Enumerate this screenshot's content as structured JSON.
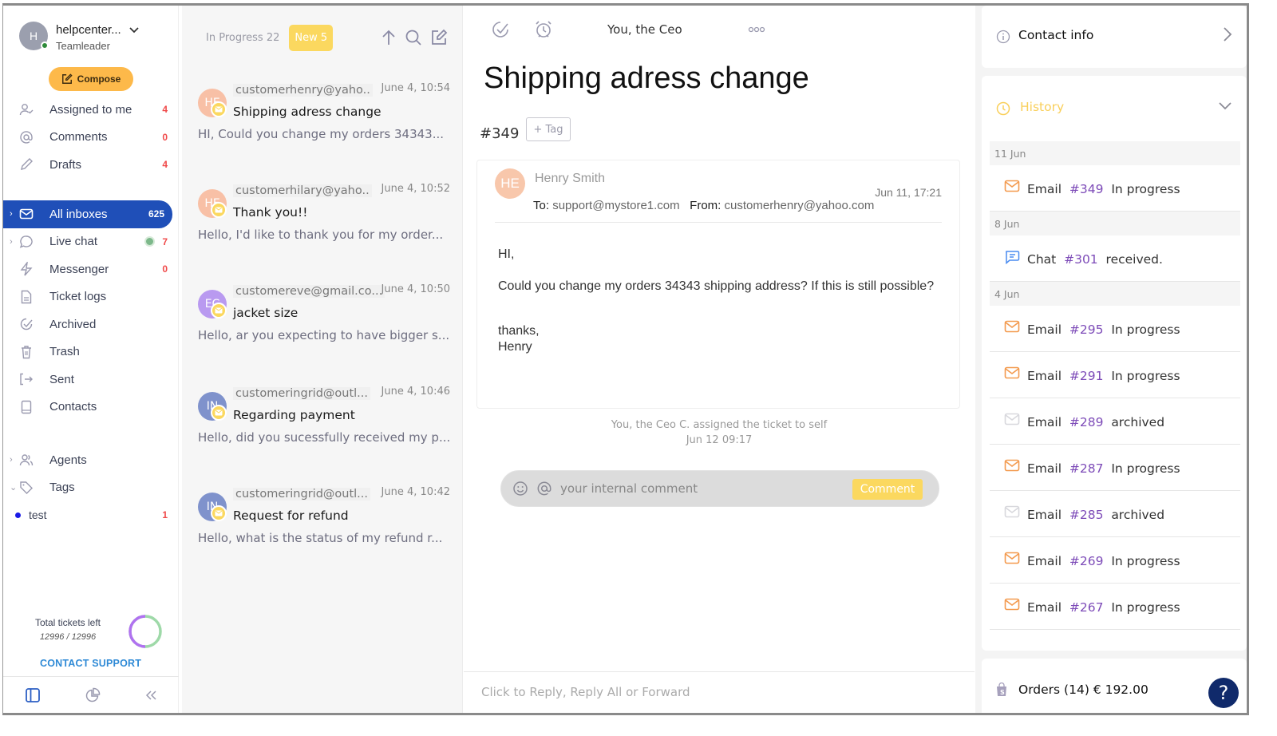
{
  "user": {
    "initial": "H",
    "name": "helpcenter...",
    "role": "Teamleader"
  },
  "compose_label": "Compose",
  "nav": [
    {
      "label": "Assigned to me",
      "count": "4",
      "icon": "user-check-icon"
    },
    {
      "label": "Comments",
      "count": "0",
      "icon": "at-icon"
    },
    {
      "label": "Drafts",
      "count": "4",
      "icon": "pencil-icon"
    }
  ],
  "inboxes": [
    {
      "label": "All inboxes",
      "count": "625",
      "icon": "mail-icon",
      "active": true
    },
    {
      "label": "Live chat",
      "count": "7",
      "icon": "chat-icon"
    },
    {
      "label": "Messenger",
      "count": "0",
      "icon": "bolt-icon"
    },
    {
      "label": "Ticket logs",
      "count": "",
      "icon": "document-icon"
    },
    {
      "label": "Archived",
      "count": "",
      "icon": "check-circle-icon"
    },
    {
      "label": "Trash",
      "count": "",
      "icon": "trash-icon"
    },
    {
      "label": "Sent",
      "count": "",
      "icon": "sign-out-icon"
    },
    {
      "label": "Contacts",
      "count": "",
      "icon": "book-icon"
    }
  ],
  "groups": [
    {
      "label": "Agents",
      "icon": "users-icon"
    },
    {
      "label": "Tags",
      "icon": "tag-icon"
    }
  ],
  "tags": [
    {
      "label": "test",
      "count": "1",
      "color": "#1a1ae6"
    }
  ],
  "tickets_left": {
    "label": "Total tickets left",
    "value": "12996 / 12996",
    "fraction": 1.0
  },
  "contact_support": "CONTACT SUPPORT",
  "list": {
    "tab_in_progress": "In Progress 22",
    "tab_new": "New 5",
    "conversations": [
      {
        "initials": "HE",
        "color": "#f8c0a6",
        "email": "customerhenry@yaho..",
        "time": "June 4, 10:54",
        "subject": "Shipping adress change",
        "preview": "HI, Could you change my orders 34343..."
      },
      {
        "initials": "HE",
        "color": "#f8c0a6",
        "email": "customerhilary@yaho..",
        "time": "June 4, 10:52",
        "subject": "Thank you!!",
        "preview": "Hello, I'd like to thank you for  my order..."
      },
      {
        "initials": "EC",
        "color": "#b99af0",
        "email": "customereve@gmail.co...",
        "time": "June 4, 10:50",
        "subject": "jacket size",
        "preview": "Hello, ar you expecting to have bigger s..."
      },
      {
        "initials": "IN",
        "color": "#7f92cc",
        "email": "customeringrid@outl...",
        "time": "June 4, 10:46",
        "subject": "Regarding payment",
        "preview": "Hello, did you sucessfully received my p..."
      },
      {
        "initials": "IN",
        "color": "#7f92cc",
        "email": "customeringrid@outl...",
        "time": "June 4, 10:42",
        "subject": "Request for refund",
        "preview": "Hello, what is the status of my refund r..."
      }
    ]
  },
  "ticket": {
    "assignee": "You, the Ceo",
    "title": "Shipping adress change",
    "number": "#349",
    "tag_button": "+ Tag",
    "message": {
      "initials": "HE",
      "sender": "Henry Smith",
      "date": "Jun 11, 17:21",
      "to_label": "To:",
      "to": "support@mystore1.com",
      "from_label": "From:",
      "from": "customerhenry@yahoo.com",
      "body": [
        "HI,",
        "Could you change my orders 34343 shipping address? If this is still possible?",
        "thanks,",
        "Henry"
      ]
    },
    "activity": "You, the Ceo C. assigned the ticket to self",
    "activity_time": "Jun 12 09:17",
    "comment_placeholder": "your internal comment",
    "comment_button": "Comment",
    "reply_hint": "Click to Reply, Reply All or Forward"
  },
  "right": {
    "contact_info": "Contact info",
    "history_label": "History",
    "history": [
      {
        "type": "date",
        "label": "11 Jun"
      },
      {
        "type": "item",
        "kind": "Email",
        "num": "#349",
        "status": "In progress",
        "icon": "email-active"
      },
      {
        "type": "date",
        "label": "8 Jun"
      },
      {
        "type": "item",
        "kind": "Chat",
        "num": "#301",
        "status": "received.",
        "icon": "chat"
      },
      {
        "type": "date",
        "label": "4 Jun"
      },
      {
        "type": "item",
        "kind": "Email",
        "num": "#295",
        "status": "In progress",
        "icon": "email-active"
      },
      {
        "type": "item",
        "kind": "Email",
        "num": "#291",
        "status": "In progress",
        "icon": "email-active"
      },
      {
        "type": "item",
        "kind": "Email",
        "num": "#289",
        "status": "archived",
        "icon": "email-archived"
      },
      {
        "type": "item",
        "kind": "Email",
        "num": "#287",
        "status": "In progress",
        "icon": "email-active"
      },
      {
        "type": "item",
        "kind": "Email",
        "num": "#285",
        "status": "archived",
        "icon": "email-archived"
      },
      {
        "type": "item",
        "kind": "Email",
        "num": "#269",
        "status": "In progress",
        "icon": "email-active"
      },
      {
        "type": "item",
        "kind": "Email",
        "num": "#267",
        "status": "In progress",
        "icon": "email-active"
      }
    ],
    "orders": "Orders (14) € 192.00",
    "help": "?"
  },
  "colors": {
    "accent": "#1f4fb8",
    "compose": "#fdb94a",
    "new_tab": "#fbd85f",
    "count_red": "#f04a4a",
    "history_num": "#7d4bb8",
    "email_icon": "#f39a4e"
  }
}
